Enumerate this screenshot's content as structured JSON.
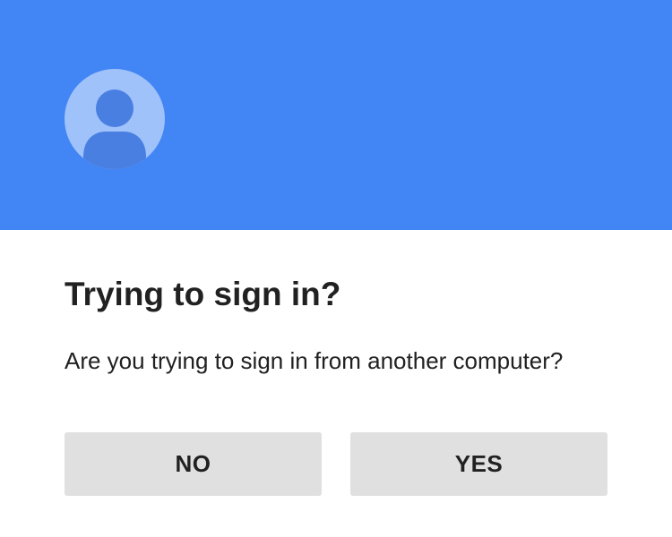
{
  "header": {
    "color": "#4285f4",
    "avatar_icon": "account-circle-icon"
  },
  "dialog": {
    "title": "Trying to sign in?",
    "message": "Are you trying to sign in from another computer?"
  },
  "buttons": {
    "no_label": "NO",
    "yes_label": "YES"
  }
}
